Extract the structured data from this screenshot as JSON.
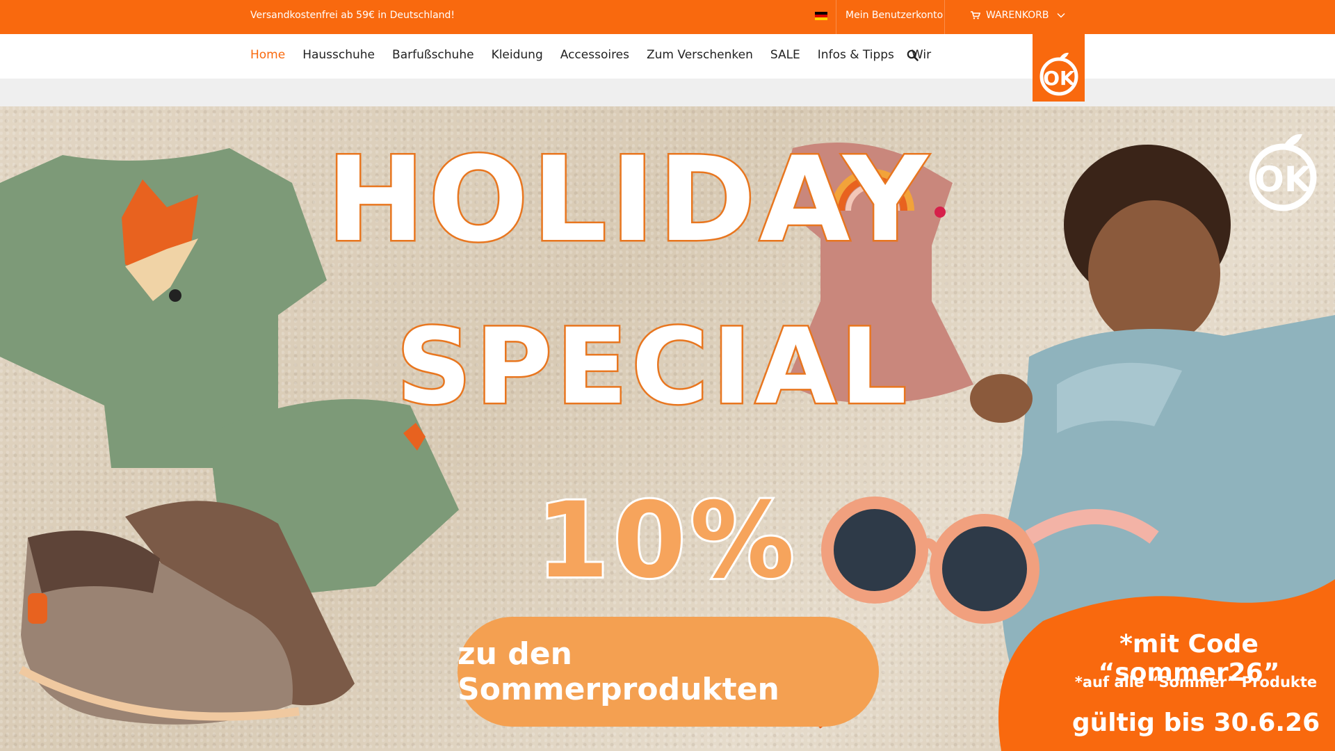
{
  "topbar": {
    "shipping_note": "Versandkostenfrei ab 59€ in Deutschland!",
    "account_label": "Mein Benutzerkonto",
    "cart_label": "WARENKORB",
    "background": "#f9690e"
  },
  "nav": {
    "items": [
      {
        "label": "Home",
        "active": true
      },
      {
        "label": "Hausschuhe"
      },
      {
        "label": "Barfußschuhe"
      },
      {
        "label": "Kleidung"
      },
      {
        "label": "Accessoires"
      },
      {
        "label": "Zum Verschenken"
      },
      {
        "label": "SALE"
      },
      {
        "label": "Infos & Tipps"
      },
      {
        "label": "Wir"
      }
    ],
    "active_color": "#f9690e"
  },
  "hero": {
    "headline_1": "HOLIDAY",
    "headline_2": "SPECIAL",
    "discount": "10%",
    "cta_label": "zu den Sommerprodukten",
    "code_line": "*mit Code “sommer26”",
    "scope_line": "*auf alle “Sommer” Produkte",
    "valid_line": "gültig bis 30.6.26"
  },
  "icons": {
    "flag": "flag-de-icon",
    "cart": "cart-icon",
    "chevron": "chevron-down-icon",
    "search": "search-icon",
    "logo": "ok-logo"
  }
}
